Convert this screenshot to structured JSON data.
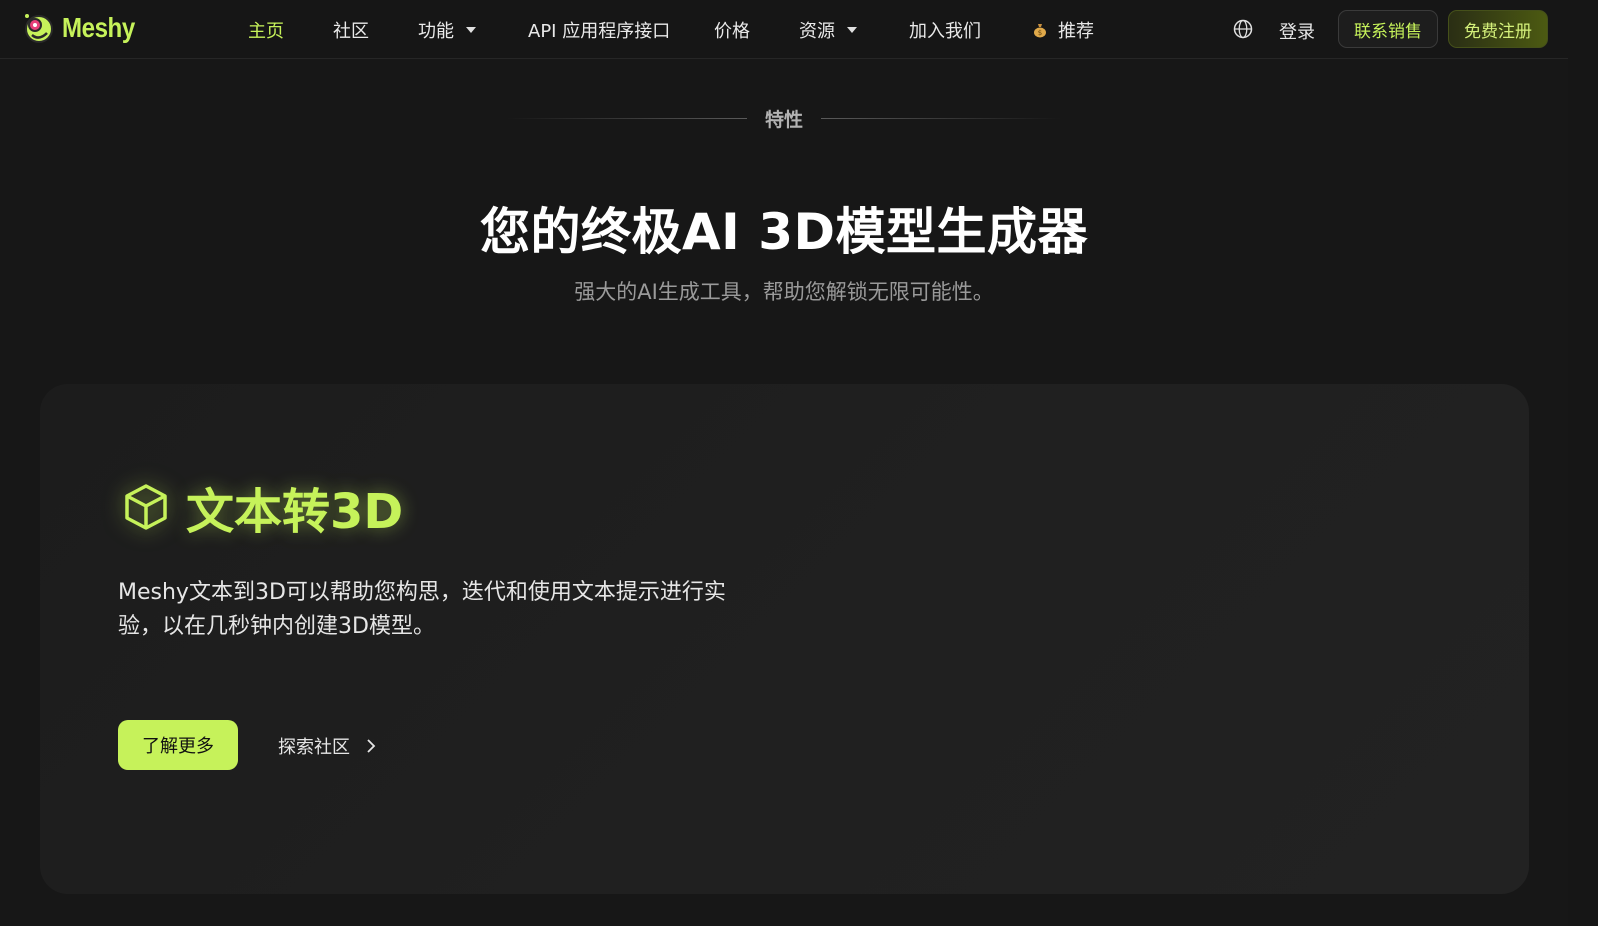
{
  "brand": {
    "name": "Meshy",
    "accent": "#c6f25a"
  },
  "nav": {
    "items": [
      {
        "label": "主页",
        "active": true
      },
      {
        "label": "社区"
      },
      {
        "label": "功能",
        "dropdown": true
      },
      {
        "label": "API 应用程序接口"
      },
      {
        "label": "价格"
      },
      {
        "label": "资源",
        "dropdown": true
      },
      {
        "label": "加入我们"
      },
      {
        "label": "推荐",
        "icon": "money-bag-icon"
      }
    ],
    "language_icon": "globe-icon",
    "login_label": "登录",
    "contact_sales_label": "联系销售",
    "signup_label": "免费注册"
  },
  "hero": {
    "eyebrow": "特性",
    "title": "您的终极AI 3D模型生成器",
    "subtitle": "强大的AI生成工具，帮助您解锁无限可能性。"
  },
  "feature": {
    "icon": "cube-icon",
    "title": "文本转3D",
    "description": "Meshy文本到3D可以帮助您构思，迭代和使用文本提示进行实验，以在几秒钟内创建3D模型。",
    "primary_button": "了解更多",
    "secondary_link": "探索社区"
  }
}
